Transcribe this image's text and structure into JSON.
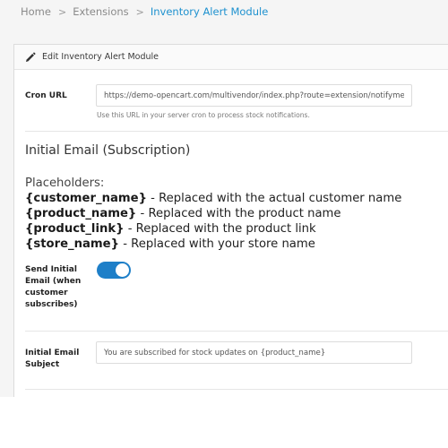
{
  "breadcrumb": [
    {
      "label": "Home",
      "active": false
    },
    {
      "label": "Extensions",
      "active": false
    },
    {
      "label": "Inventory Alert Module",
      "active": true
    }
  ],
  "card": {
    "title": "Edit Inventory Alert Module"
  },
  "cron": {
    "label": "Cron URL",
    "value": "https://demo-opencart.com/multivendor/index.php?route=extension/notifyme/c",
    "help": "Use this URL in your server cron to process stock notifications."
  },
  "initial_email": {
    "section_title": "Initial Email (Subscription)",
    "placeholders_heading": "Placeholders:",
    "placeholders": [
      {
        "token": "{customer_name}",
        "desc": " - Replaced with the actual customer name"
      },
      {
        "token": "{product_name}",
        "desc": " - Replaced with the product name"
      },
      {
        "token": "{product_link}",
        "desc": " - Replaced with the product link"
      },
      {
        "token": "{store_name}",
        "desc": " - Replaced with your store name"
      }
    ],
    "send_label_lines": [
      "Send Initial",
      "Email (when",
      "customer",
      "subscribes)"
    ],
    "send_enabled": true,
    "subject_label_lines": [
      "Initial Email",
      "Subject"
    ],
    "subject_value": "You are subscribed for stock updates on {product_name}"
  },
  "colors": {
    "accent": "#1e91cf",
    "toggle_on": "#1e7fc8"
  }
}
